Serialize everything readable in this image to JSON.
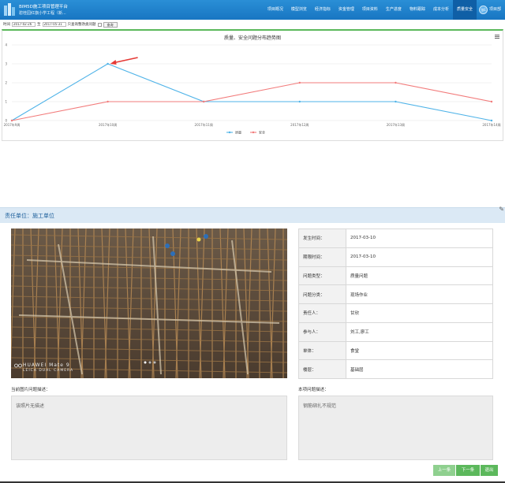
{
  "app": {
    "title": "BIM5D施工项目管理平台",
    "subtitle": "碧桂园红旗小学工程（新..."
  },
  "nav": {
    "items": [
      "项目概况",
      "模型浏览",
      "经济指标",
      "资金管理",
      "项目资料",
      "生产进度",
      "物料跟踪",
      "成本分析",
      "质量安全"
    ],
    "active_index": 8,
    "user_badge": "张E",
    "user_label": "项目部"
  },
  "filter": {
    "time_label": "时间",
    "start_date": "2017-02-26",
    "to_label": "至",
    "end_date": "2017-05-31",
    "only_label": "只查询整改类问题",
    "query_label": "查询"
  },
  "chart_data": {
    "type": "line",
    "title": "质量、安全问题分布趋势图",
    "categories": [
      "2017年9周",
      "2017年10周",
      "2017年11周",
      "2017年12周",
      "2017年13周",
      "2017年14周"
    ],
    "series": [
      {
        "name": "质量",
        "color": "#4fb3e8",
        "values": [
          0,
          3,
          1,
          1,
          1,
          0
        ]
      },
      {
        "name": "安全",
        "color": "#f27b7b",
        "values": [
          0,
          1,
          1,
          2,
          2,
          1
        ]
      }
    ],
    "ylim": [
      0,
      4
    ],
    "yticks": [
      "0",
      "1",
      "2",
      "3",
      "4"
    ],
    "grid": true,
    "legend": "bottom-center",
    "annotation": "red arrow pointing to peak of 质量 series at 2017年10周"
  },
  "detail": {
    "header": "责任单位：施工单位",
    "corner_glyph": "✎",
    "photo": {
      "caption1": "HUAWEI Mate 9",
      "caption2": "LEICA DUAL CAMERA"
    },
    "rows": [
      {
        "key": "发生时间：",
        "value": "2017-03-10"
      },
      {
        "key": "期限时间：",
        "value": "2017-03-10"
      },
      {
        "key": "问题类型：",
        "value": "质量问题"
      },
      {
        "key": "问题分类：",
        "value": "现场作业"
      },
      {
        "key": "责任人：",
        "value": "甘欣"
      },
      {
        "key": "参与人：",
        "value": "刘工,廖工"
      },
      {
        "key": "单体：",
        "value": "食堂"
      },
      {
        "key": "楼层：",
        "value": "基础层"
      }
    ],
    "photo_desc_label": "当前图片问题描述：",
    "photo_desc_text": "该照片无描述",
    "issue_desc_label": "本项问题描述：",
    "issue_desc_text": "钢筋绑扎不规范"
  },
  "buttons": {
    "prev": "上一条",
    "next": "下一条",
    "exit": "退出"
  },
  "colors": {
    "topbar": "#1f82cc",
    "nav_active": "#0f5fa6",
    "header_band": "#dbe9f5",
    "button_green": "#5cb85c"
  }
}
